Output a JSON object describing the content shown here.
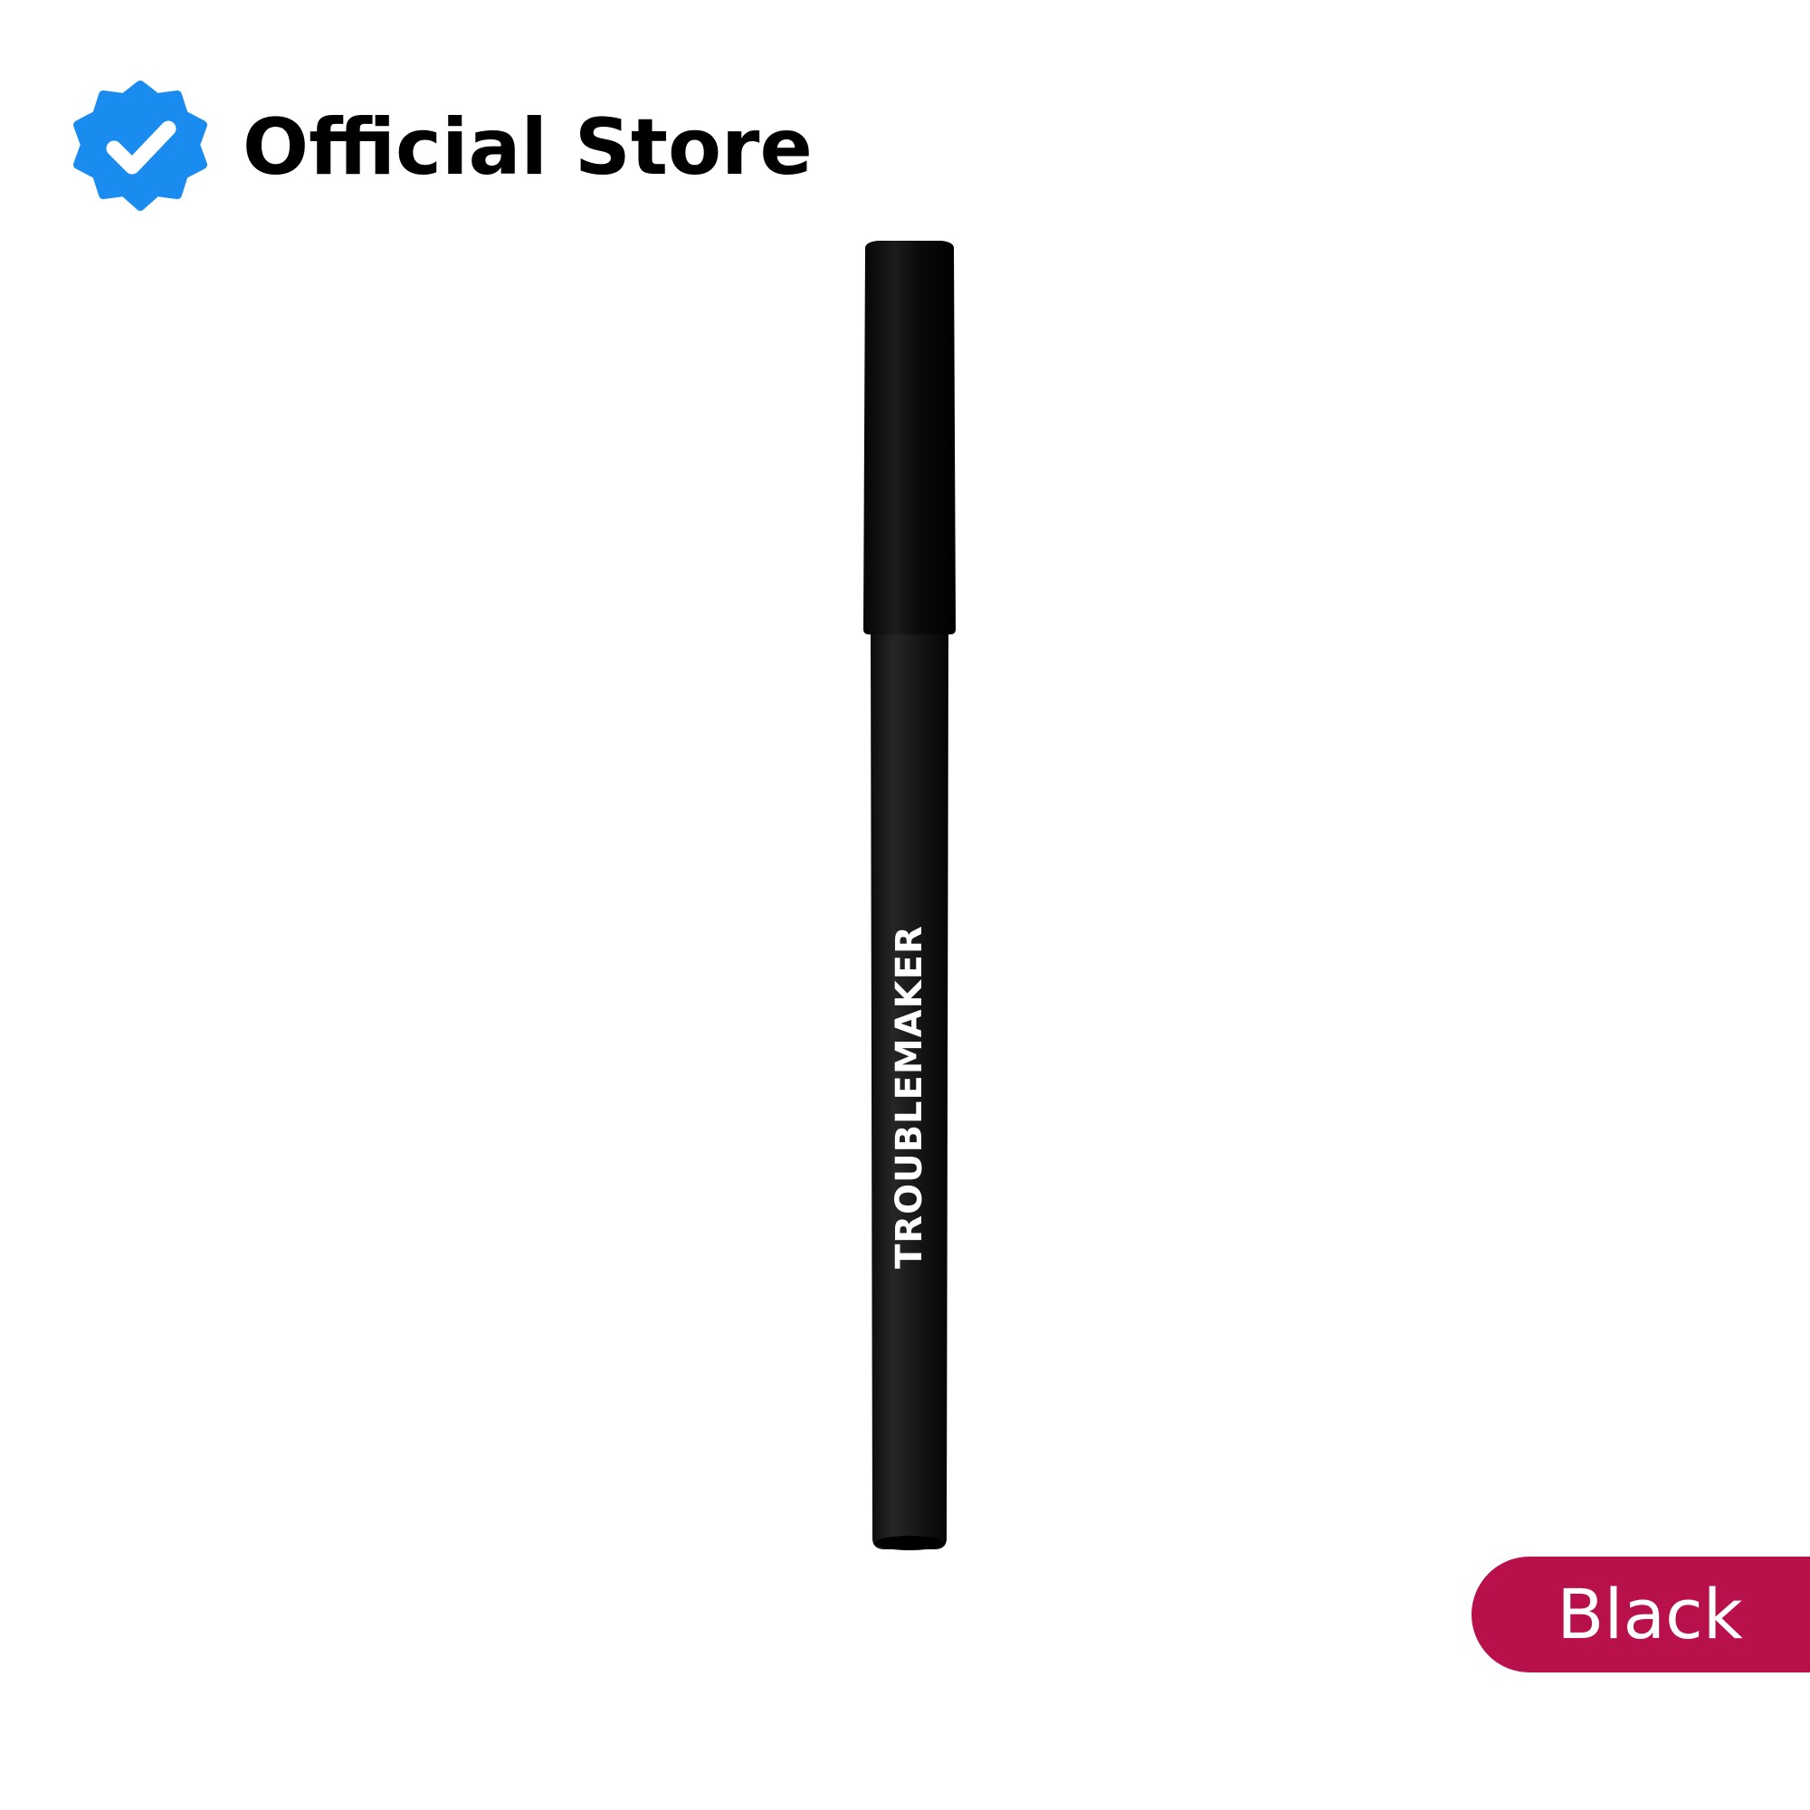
{
  "store": {
    "label": "Official Store",
    "icon": "verified-badge-icon",
    "icon_color": "#1a8cf0"
  },
  "product": {
    "brand_text": "TROUBLEMAKER",
    "image": "black-eyeliner-pencil"
  },
  "variant": {
    "label": "Black",
    "badge_color": "#b8104a"
  }
}
